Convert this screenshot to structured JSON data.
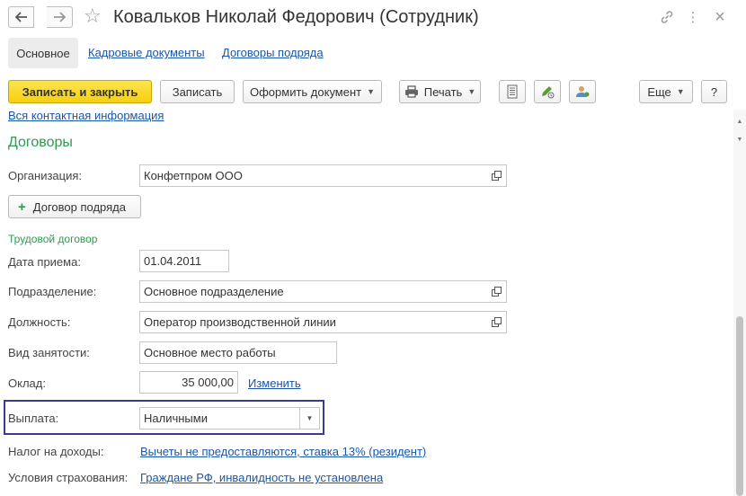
{
  "window": {
    "title": "Ковальков Николай Федорович (Сотрудник)",
    "back_icon": "arrow-left-icon",
    "forward_icon": "arrow-right-icon",
    "favorite_icon": "star-icon",
    "link_icon": "link-icon",
    "more_icon": "more-vertical-icon",
    "close_icon": "close-icon",
    "close_glyph": "×",
    "more_glyph": "⋮"
  },
  "tabs": {
    "active": "Основное",
    "items": [
      "Кадровые документы",
      "Договоры подряда"
    ]
  },
  "toolbar": {
    "save_close": "Записать и закрыть",
    "save": "Записать",
    "make_document": "Оформить документ",
    "print": "Печать",
    "more": "Еще",
    "help": "?",
    "icons": [
      "documents-icon",
      "edit-signature-icon",
      "user-access-icon"
    ]
  },
  "content": {
    "contact_link": "Вся контактная информация",
    "section_title": "Договоры",
    "organization_label": "Организация:",
    "organization_value": "Конфетпром ООО",
    "add_contract_button": "Договор подряда",
    "add_contract_plus": "+",
    "subsection_title": "Трудовой договор",
    "hire_date_label": "Дата приема:",
    "hire_date_value": "01.04.2011",
    "department_label": "Подразделение:",
    "department_value": "Основное подразделение",
    "position_label": "Должность:",
    "position_value": "Оператор производственной линии",
    "employment_label": "Вид занятости:",
    "employment_value": "Основное место работы",
    "salary_label": "Оклад:",
    "salary_value": "35 000,00",
    "salary_change_link": "Изменить",
    "payment_label": "Выплата:",
    "payment_value": "Наличными",
    "tax_label": "Налог на доходы:",
    "tax_link": "Вычеты не предоставляются, ставка 13% (резидент)",
    "insurance_label": "Условия страхования:",
    "insurance_link": "Граждане РФ, инвалидность не установлена"
  },
  "colors": {
    "accent_yellow": "#f5d010",
    "link_blue": "#1a56a8",
    "section_green": "#2e9a52",
    "highlight_border": "#3a3d8e"
  }
}
